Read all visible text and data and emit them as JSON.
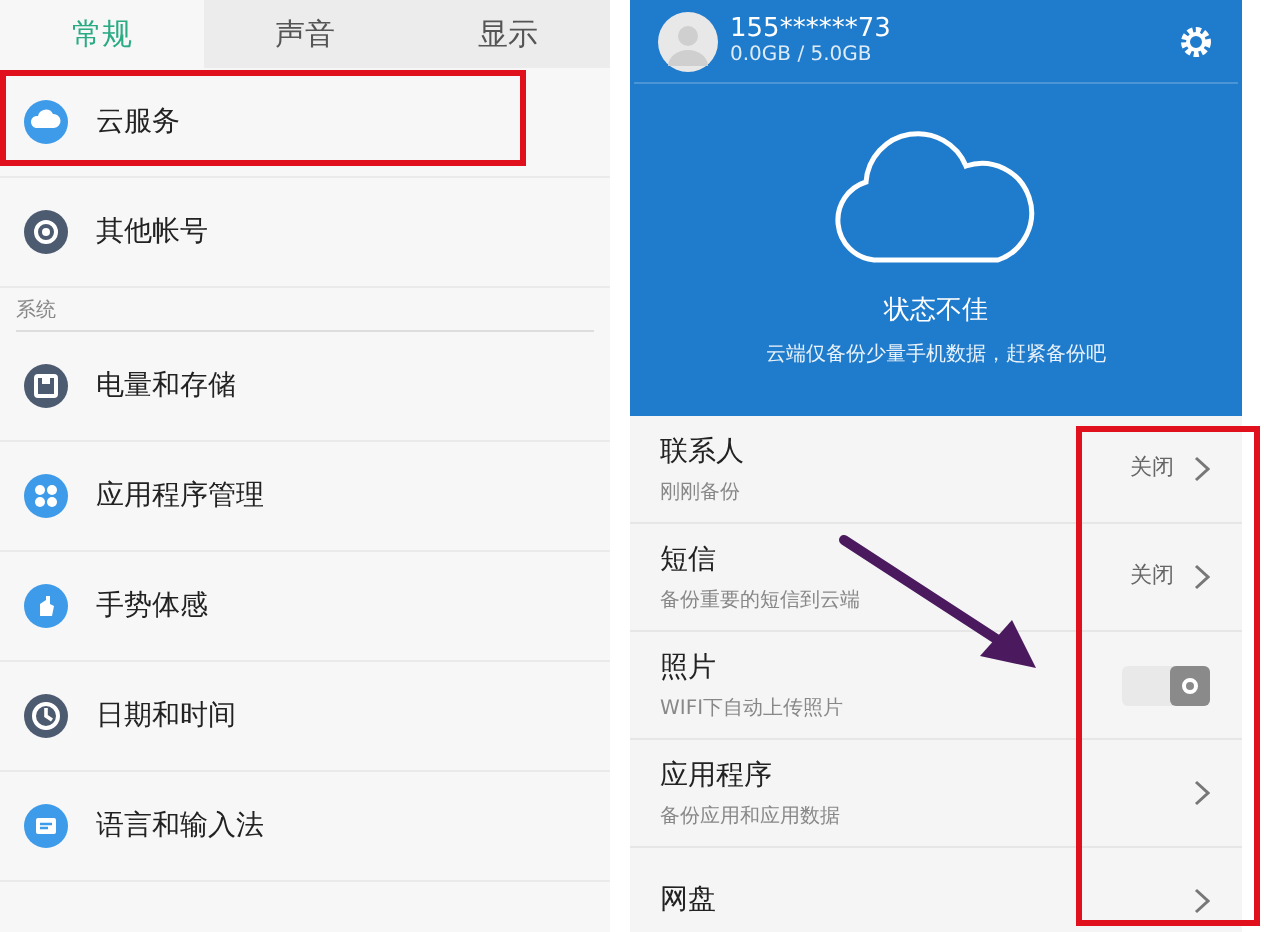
{
  "settings_panel": {
    "tabs": [
      {
        "label": "常规",
        "selected": true
      },
      {
        "label": "声音",
        "selected": false
      },
      {
        "label": "显示",
        "selected": false
      }
    ],
    "items": [
      {
        "kind": "item",
        "label": "云服务",
        "highlighted": true
      },
      {
        "kind": "item",
        "label": "其他帐号",
        "highlighted": false
      },
      {
        "kind": "section",
        "label": "系统"
      },
      {
        "kind": "item",
        "label": "电量和存储",
        "highlighted": false
      },
      {
        "kind": "item",
        "label": "应用程序管理",
        "highlighted": false
      },
      {
        "kind": "item",
        "label": "手势体感",
        "highlighted": false
      },
      {
        "kind": "item",
        "label": "日期和时间",
        "highlighted": false
      },
      {
        "kind": "item",
        "label": "语言和输入法",
        "highlighted": false
      }
    ]
  },
  "cloud_panel": {
    "account": "155******73",
    "storage": "0.0GB / 5.0GB",
    "status": "状态不佳",
    "status_detail": "云端仅备份少量手机数据，赶紧备份吧",
    "rows": [
      {
        "kind": "link",
        "title": "联系人",
        "subtitle": "刚刚备份",
        "value": "关闭"
      },
      {
        "kind": "link",
        "title": "短信",
        "subtitle": "备份重要的短信到云端",
        "value": "关闭"
      },
      {
        "kind": "toggle",
        "title": "照片",
        "subtitle": "WIFI下自动上传照片",
        "on": true
      },
      {
        "kind": "link",
        "title": "应用程序",
        "subtitle": "备份应用和应用数据"
      },
      {
        "kind": "link",
        "title": "网盘"
      }
    ]
  }
}
